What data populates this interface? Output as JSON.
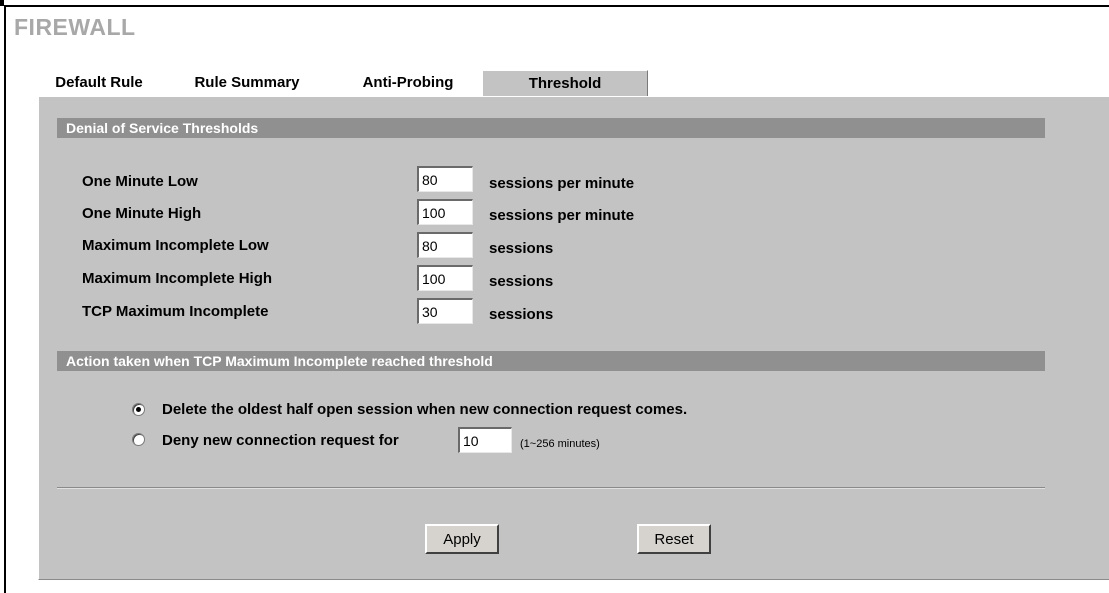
{
  "page": {
    "title": "FIREWALL"
  },
  "tabs": [
    {
      "label": "Default Rule",
      "active": false
    },
    {
      "label": "Rule Summary",
      "active": false
    },
    {
      "label": "Anti-Probing",
      "active": false
    },
    {
      "label": "Threshold",
      "active": true
    }
  ],
  "dos_section": {
    "header": "Denial of Service Thresholds",
    "rows": [
      {
        "label": "One Minute Low",
        "value": "80",
        "unit": "sessions per minute"
      },
      {
        "label": "One Minute High",
        "value": "100",
        "unit": "sessions per minute"
      },
      {
        "label": "Maximum Incomplete Low",
        "value": "80",
        "unit": "sessions"
      },
      {
        "label": "Maximum Incomplete High",
        "value": "100",
        "unit": "sessions"
      },
      {
        "label": "TCP Maximum Incomplete",
        "value": "30",
        "unit": "sessions"
      }
    ]
  },
  "action_section": {
    "header": "Action taken when TCP Maximum Incomplete reached threshold",
    "options": [
      {
        "label": "Delete the oldest half open session when new connection request comes.",
        "selected": true
      },
      {
        "label": "Deny new connection request for",
        "selected": false,
        "value": "10",
        "hint": "(1~256 minutes)"
      }
    ]
  },
  "buttons": {
    "apply": "Apply",
    "reset": "Reset"
  },
  "colors": {
    "panel": "#c3c3c3",
    "section_bar": "#8f908f",
    "title": "#a8a8a8"
  }
}
